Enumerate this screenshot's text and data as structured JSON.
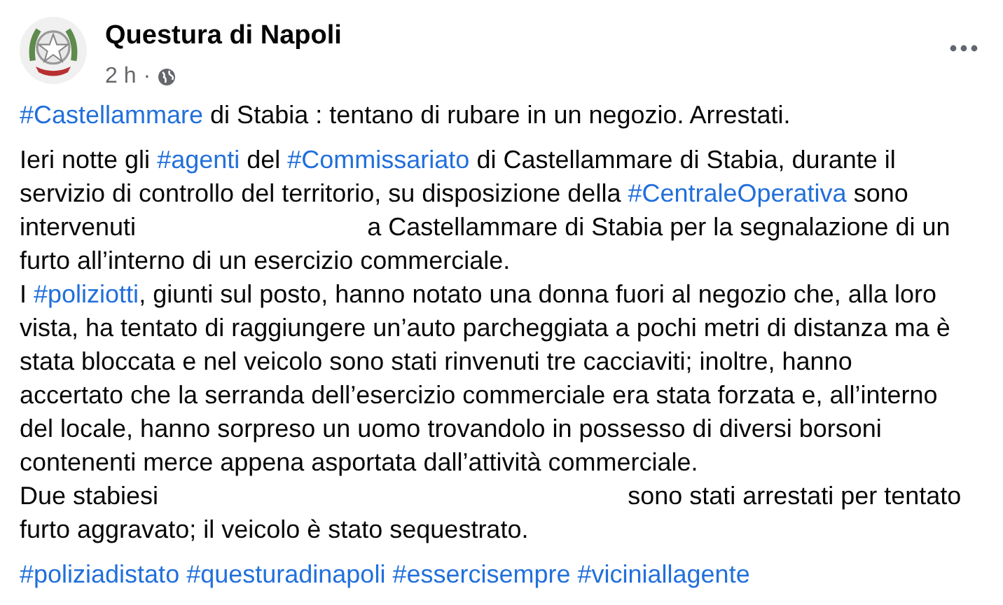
{
  "post": {
    "author": "Questura di Napoli",
    "time": "2 h",
    "separator": "·",
    "paragraphs": [
      {
        "lines": [
          [
            {
              "kind": "hashtag",
              "text": "#Castellammare"
            },
            {
              "kind": "text",
              "text": " di Stabia : tentano di rubare in un negozio. Arrestati."
            }
          ]
        ]
      },
      {
        "lines": [
          [
            {
              "kind": "text",
              "text": "Ieri notte gli "
            },
            {
              "kind": "hashtag",
              "text": "#agenti"
            },
            {
              "kind": "text",
              "text": " del "
            },
            {
              "kind": "hashtag",
              "text": "#Commissariato"
            },
            {
              "kind": "text",
              "text": " di Castellammare di Stabia, durante il"
            }
          ],
          [
            {
              "kind": "text",
              "text": "servizio di controllo del territorio, su disposizione della "
            },
            {
              "kind": "hashtag",
              "text": "#CentraleOperativa"
            },
            {
              "kind": "text",
              "text": " sono"
            }
          ],
          [
            {
              "kind": "text",
              "text": "intervenuti"
            },
            {
              "kind": "gap"
            },
            {
              "kind": "text",
              "text": "a Castellammare di Stabia per la segnalazione di un"
            }
          ],
          [
            {
              "kind": "text",
              "text": "furto all’interno di un esercizio commerciale."
            }
          ],
          [
            {
              "kind": "text",
              "text": "I "
            },
            {
              "kind": "hashtag",
              "text": "#poliziotti"
            },
            {
              "kind": "text",
              "text": ", giunti sul posto, hanno notato una donna fuori al negozio che, alla loro"
            }
          ],
          [
            {
              "kind": "text",
              "text": "vista, ha tentato di raggiungere un’auto parcheggiata a pochi metri di distanza ma è"
            }
          ],
          [
            {
              "kind": "text",
              "text": "stata bloccata e nel veicolo sono stati rinvenuti tre cacciaviti; inoltre, hanno"
            }
          ],
          [
            {
              "kind": "text",
              "text": "accertato che la serranda dell’esercizio commerciale era stata forzata e, all’interno"
            }
          ],
          [
            {
              "kind": "text",
              "text": "del locale, hanno sorpreso un uomo trovandolo in possesso di diversi borsoni"
            }
          ],
          [
            {
              "kind": "text",
              "text": "contenenti merce appena asportata dall’attività commerciale."
            }
          ],
          [
            {
              "kind": "text",
              "text": "Due stabiesi"
            },
            {
              "kind": "gap"
            },
            {
              "kind": "text",
              "text": "sono stati arrestati per tentato"
            }
          ],
          [
            {
              "kind": "text",
              "text": "furto aggravato; il veicolo è stato sequestrato."
            }
          ]
        ]
      },
      {
        "lines": [
          [
            {
              "kind": "hashtag",
              "text": "#poliziadistato"
            },
            {
              "kind": "space"
            },
            {
              "kind": "hashtag",
              "text": "#questuradinapoli"
            },
            {
              "kind": "space"
            },
            {
              "kind": "hashtag",
              "text": "#essercisempre"
            },
            {
              "kind": "space"
            },
            {
              "kind": "hashtag",
              "text": "#viciniallagente"
            }
          ]
        ]
      }
    ]
  }
}
